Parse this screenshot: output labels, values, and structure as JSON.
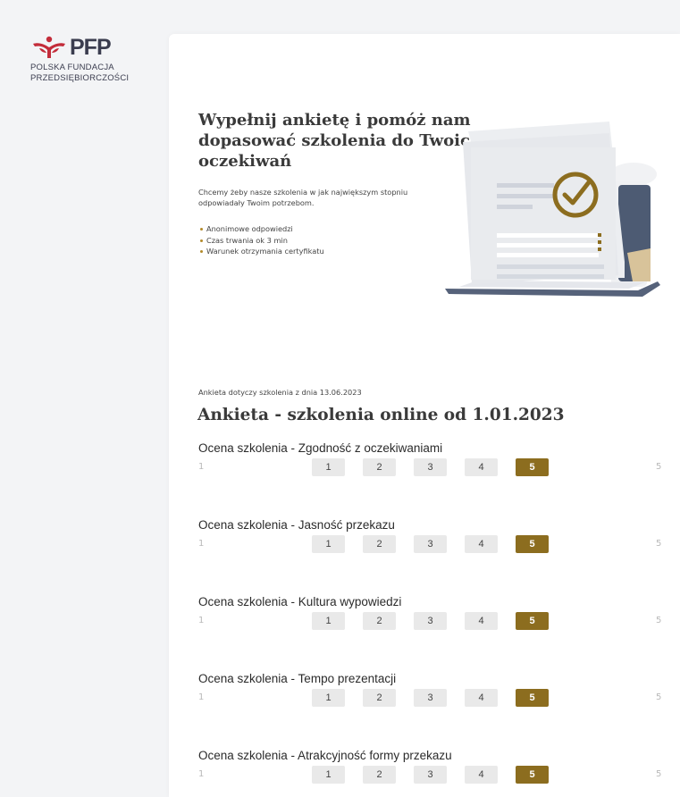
{
  "brand": {
    "name": "PFP",
    "subtitle_line1": "POLSKA FUNDACJA",
    "subtitle_line2": "PRZEDSIĘBIORCZOŚCI",
    "accent_red": "#c32c3a",
    "text_dark": "#3b3d4f"
  },
  "hero": {
    "title": "Wypełnij ankietę i pomóż nam dopasować szkolenia do Twoich oczekiwań",
    "description": "Chcemy żeby nasze szkolenia w jak największym stopniu odpowiadały Twoim potrzebom.",
    "bullets": [
      "Anonimowe odpowiedzi",
      "Czas trwania ok 3 min",
      "Warunek otrzymania certyfikatu"
    ],
    "illustration_icon": "document-check-laptop-illustration"
  },
  "survey": {
    "caption": "Ankieta dotyczy szkolenia z dnia 13.06.2023",
    "title": "Ankieta - szkolenia online od 1.01.2023",
    "scale_min_label": "1",
    "scale_max_label": "5",
    "options": [
      "1",
      "2",
      "3",
      "4",
      "5"
    ],
    "questions": [
      {
        "label": "Ocena szkolenia - Zgodność z oczekiwaniami",
        "selected": "5"
      },
      {
        "label": "Ocena szkolenia - Jasność przekazu",
        "selected": "5"
      },
      {
        "label": "Ocena szkolenia - Kultura wypowiedzi",
        "selected": "5"
      },
      {
        "label": "Ocena szkolenia - Tempo prezentacji",
        "selected": "5"
      },
      {
        "label": "Ocena szkolenia - Atrakcyjność formy przekazu",
        "selected": "5"
      }
    ],
    "selected_color": "#8c6d1f",
    "unselected_color": "#e9e9e9"
  }
}
